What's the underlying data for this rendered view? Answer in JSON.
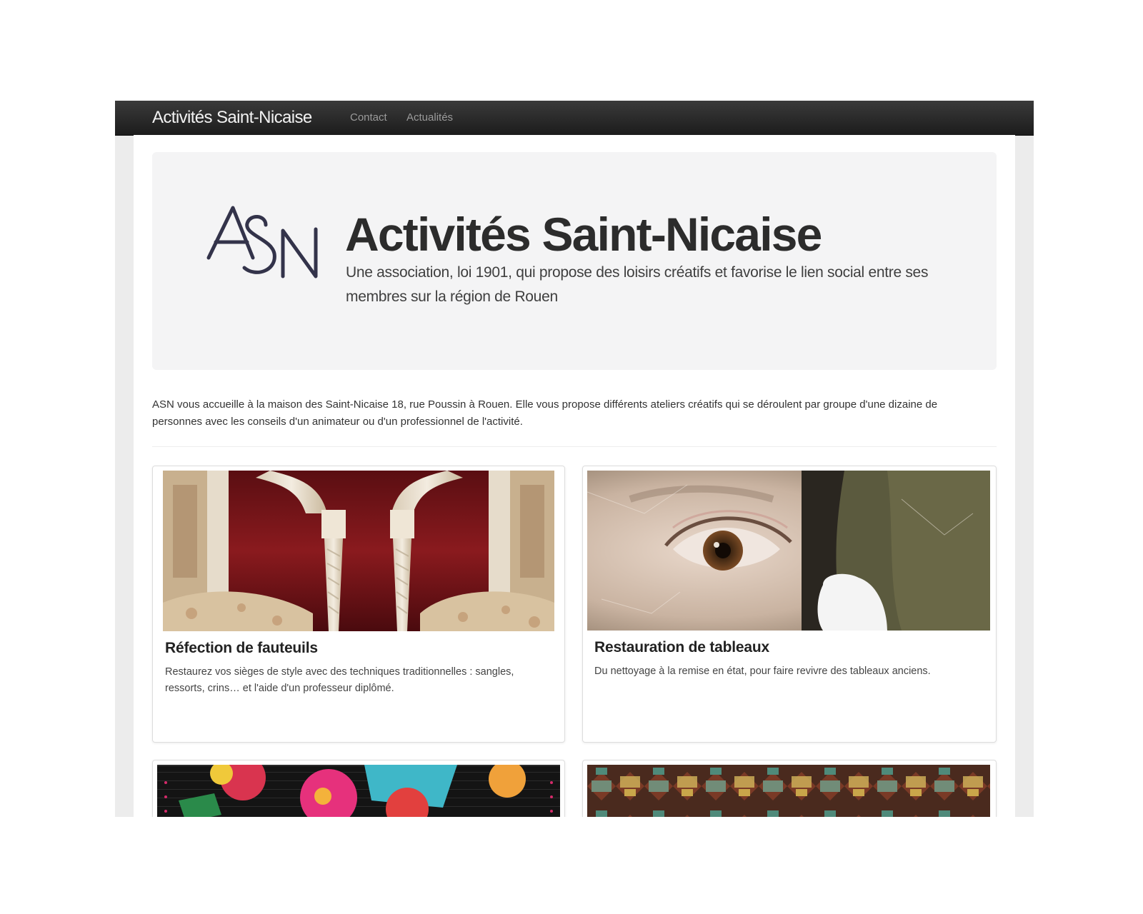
{
  "navbar": {
    "brand": "Activités Saint-Nicaise",
    "links": [
      "Contact",
      "Actualités"
    ]
  },
  "hero": {
    "logo_text": "ASN",
    "title": "Activités Saint-Nicaise",
    "subtitle": "Une association, loi 1901, qui propose des loisirs créatifs et favorise le lien social entre ses membres sur la région de Rouen"
  },
  "intro": "ASN vous accueille à la maison des Saint-Nicaise 18, rue Poussin à Rouen. Elle vous propose différents ateliers créatifs qui se déroulent par groupe d'une dizaine de personnes avec les conseils d'un animateur ou d'un professionnel de l'activité.",
  "cards": [
    {
      "title": "Réfection de fauteuils",
      "description": "Restaurez vos sièges de style avec des techniques traditionnelles : sangles, ressorts, crins… et l'aide d'un professeur diplômé."
    },
    {
      "title": "Restauration de tableaux",
      "description": "Du nettoyage à la remise en état, pour faire revivre des tableaux anciens."
    },
    {
      "title": "",
      "description": ""
    },
    {
      "title": "",
      "description": ""
    }
  ],
  "colors": {
    "navbar": "#222222",
    "hero_background": "#f4f4f5",
    "logo": "#33334a",
    "frame": "#ececec"
  }
}
